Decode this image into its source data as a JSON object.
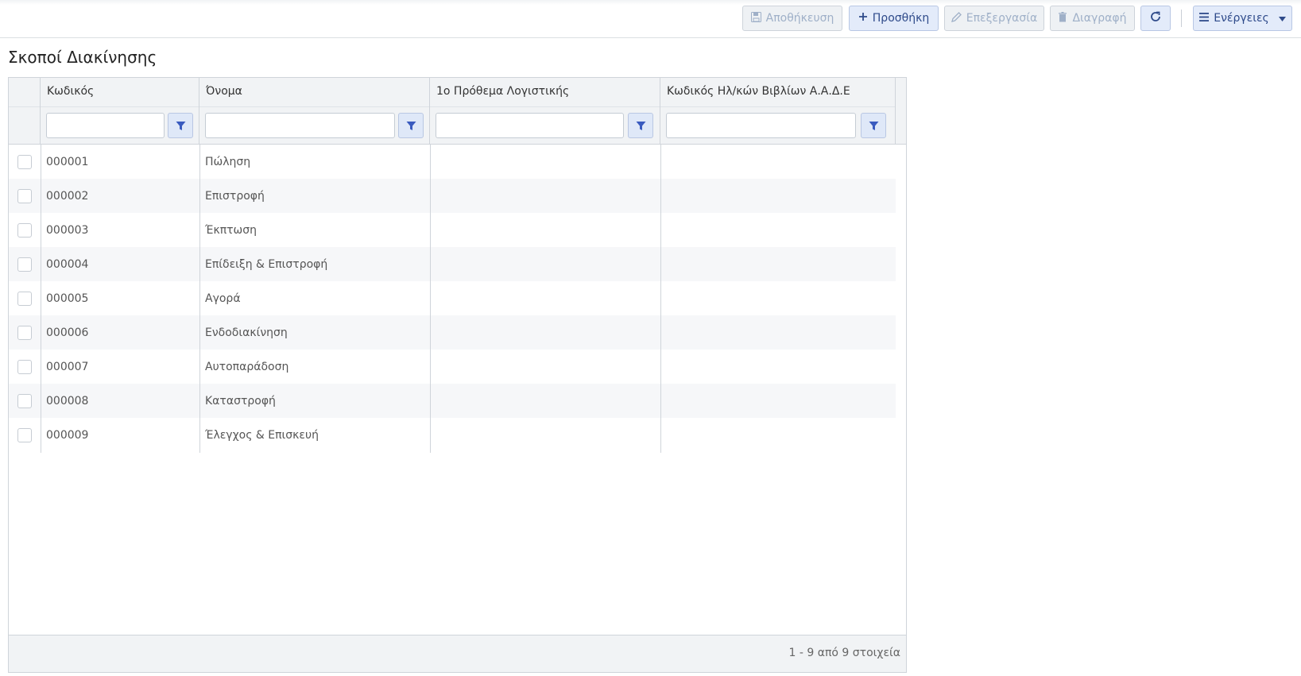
{
  "toolbar": {
    "save_label": "Αποθήκευση",
    "add_label": "Προσθήκη",
    "edit_label": "Επεξεργασία",
    "delete_label": "Διαγραφή",
    "actions_label": "Ενέργειες"
  },
  "page": {
    "title": "Σκοποί Διακίνησης"
  },
  "grid": {
    "columns": [
      {
        "label": "Κωδικός"
      },
      {
        "label": "Όνομα"
      },
      {
        "label": "1ο Πρόθεμα Λογιστικής"
      },
      {
        "label": "Κωδικός Ηλ/κών Βιβλίων Α.Α.Δ.Ε"
      }
    ],
    "rows": [
      {
        "code": "000001",
        "name": "Πώληση",
        "prefix": "",
        "aade": ""
      },
      {
        "code": "000002",
        "name": "Επιστροφή",
        "prefix": "",
        "aade": ""
      },
      {
        "code": "000003",
        "name": "Έκπτωση",
        "prefix": "",
        "aade": ""
      },
      {
        "code": "000004",
        "name": "Επίδειξη & Επιστροφή",
        "prefix": "",
        "aade": ""
      },
      {
        "code": "000005",
        "name": "Αγορά",
        "prefix": "",
        "aade": ""
      },
      {
        "code": "000006",
        "name": "Ενδοδιακίνηση",
        "prefix": "",
        "aade": ""
      },
      {
        "code": "000007",
        "name": "Αυτοπαράδοση",
        "prefix": "",
        "aade": ""
      },
      {
        "code": "000008",
        "name": "Καταστροφή",
        "prefix": "",
        "aade": ""
      },
      {
        "code": "000009",
        "name": "Έλεγχος & Επισκευή",
        "prefix": "",
        "aade": ""
      }
    ],
    "pager_info": "1 - 9 από 9 στοιχεία"
  },
  "colors": {
    "accent": "#2e4a8a",
    "filter_icon": "#3a5bbf",
    "disabled_text": "#9fb0c8"
  }
}
